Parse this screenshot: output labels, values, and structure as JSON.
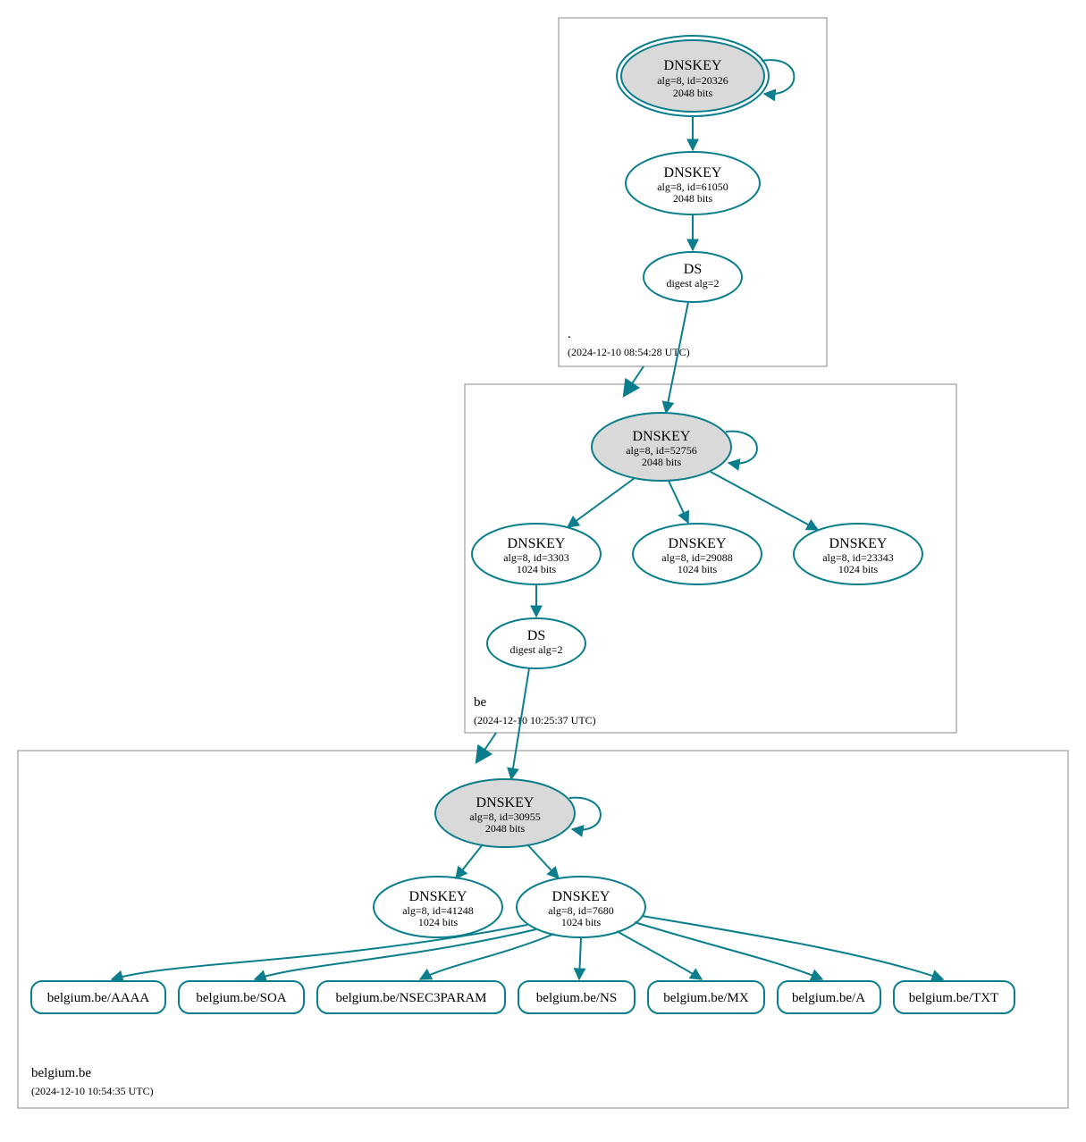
{
  "colors": {
    "stroke": "#0a7e8c",
    "ksk_fill": "#d9d9d9"
  },
  "zones": {
    "root": {
      "label": ".",
      "timestamp": "(2024-12-10 08:54:28 UTC)"
    },
    "be": {
      "label": "be",
      "timestamp": "(2024-12-10 10:25:37 UTC)"
    },
    "domain": {
      "label": "belgium.be",
      "timestamp": "(2024-12-10 10:54:35 UTC)"
    }
  },
  "nodes": {
    "root_ksk": {
      "title": "DNSKEY",
      "line2": "alg=8, id=20326",
      "line3": "2048 bits"
    },
    "root_zsk": {
      "title": "DNSKEY",
      "line2": "alg=8, id=61050",
      "line3": "2048 bits"
    },
    "root_ds": {
      "title": "DS",
      "line2": "digest alg=2",
      "line3": ""
    },
    "be_ksk": {
      "title": "DNSKEY",
      "line2": "alg=8, id=52756",
      "line3": "2048 bits"
    },
    "be_zsk1": {
      "title": "DNSKEY",
      "line2": "alg=8, id=3303",
      "line3": "1024 bits"
    },
    "be_zsk2": {
      "title": "DNSKEY",
      "line2": "alg=8, id=29088",
      "line3": "1024 bits"
    },
    "be_zsk3": {
      "title": "DNSKEY",
      "line2": "alg=8, id=23343",
      "line3": "1024 bits"
    },
    "be_ds": {
      "title": "DS",
      "line2": "digest alg=2",
      "line3": ""
    },
    "dom_ksk": {
      "title": "DNSKEY",
      "line2": "alg=8, id=30955",
      "line3": "2048 bits"
    },
    "dom_zsk1": {
      "title": "DNSKEY",
      "line2": "alg=8, id=41248",
      "line3": "1024 bits"
    },
    "dom_zsk2": {
      "title": "DNSKEY",
      "line2": "alg=8, id=7680",
      "line3": "1024 bits"
    }
  },
  "rrsets": {
    "aaaa": "belgium.be/AAAA",
    "soa": "belgium.be/SOA",
    "nsec3param": "belgium.be/NSEC3PARAM",
    "ns": "belgium.be/NS",
    "mx": "belgium.be/MX",
    "a": "belgium.be/A",
    "txt": "belgium.be/TXT"
  }
}
